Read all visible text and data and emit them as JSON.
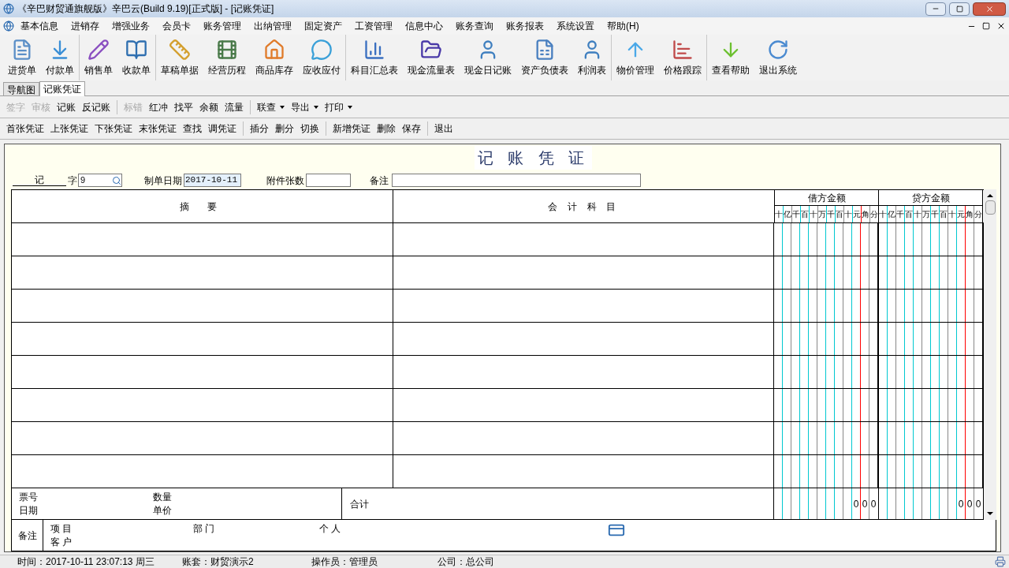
{
  "window": {
    "title": "《辛巴财贸通旗舰版》辛巴云(Build 9.19)[正式版] - [记账凭证]"
  },
  "menu": [
    "基本信息",
    "进销存",
    "增强业务",
    "会员卡",
    "账务管理",
    "出纳管理",
    "固定资产",
    "工资管理",
    "信息中心",
    "账务查询",
    "账务报表",
    "系统设置",
    "帮助(H)"
  ],
  "toolbar": [
    [
      {
        "label": "进货单",
        "kind": "document"
      },
      {
        "label": "付款单",
        "kind": "download"
      }
    ],
    [
      {
        "label": "销售单",
        "kind": "pencil"
      },
      {
        "label": "收款单",
        "kind": "book"
      }
    ],
    [
      {
        "label": "草稿单据",
        "kind": "ruler"
      },
      {
        "label": "经营历程",
        "kind": "film"
      },
      {
        "label": "商品库存",
        "kind": "house"
      },
      {
        "label": "应收应付",
        "kind": "chat"
      }
    ],
    [
      {
        "label": "科目汇总表",
        "kind": "chart"
      },
      {
        "label": "现金流量表",
        "kind": "folder"
      },
      {
        "label": "现金日记账",
        "kind": "person"
      },
      {
        "label": "资产负债表",
        "kind": "report"
      },
      {
        "label": "利润表",
        "kind": "person"
      }
    ],
    [
      {
        "label": "物价管理",
        "kind": "arrow-up"
      },
      {
        "label": "价格跟踪",
        "kind": "bar-chart"
      }
    ],
    [
      {
        "label": "查看帮助",
        "kind": "arrow-down"
      },
      {
        "label": "退出系统",
        "kind": "refresh"
      }
    ]
  ],
  "tabs": [
    {
      "label": "导航图",
      "selected": false
    },
    {
      "label": "记账凭证",
      "selected": true
    }
  ],
  "action_bar": [
    [
      {
        "label": "签字",
        "disabled": true,
        "dropdown": false
      },
      {
        "label": "审核",
        "disabled": true,
        "dropdown": false
      },
      {
        "label": "记账",
        "disabled": false,
        "dropdown": false
      },
      {
        "label": "反记账",
        "disabled": false,
        "dropdown": false
      }
    ],
    [
      {
        "label": "标错",
        "disabled": true,
        "dropdown": false
      },
      {
        "label": "红冲",
        "disabled": false,
        "dropdown": false
      },
      {
        "label": "找平",
        "disabled": false,
        "dropdown": false
      },
      {
        "label": "余额",
        "disabled": false,
        "dropdown": false
      },
      {
        "label": "流量",
        "disabled": false,
        "dropdown": false
      }
    ],
    [
      {
        "label": "联查",
        "disabled": false,
        "dropdown": true
      },
      {
        "label": "导出",
        "disabled": false,
        "dropdown": true
      },
      {
        "label": "打印",
        "disabled": false,
        "dropdown": true
      }
    ]
  ],
  "nav_bar": [
    [
      "首张凭证",
      "上张凭证",
      "下张凭证",
      "末张凭证",
      "查找",
      "调凭证"
    ],
    [
      "插分",
      "删分",
      "切换"
    ],
    [
      "新增凭证",
      "删除",
      "保存"
    ],
    [
      "退出"
    ]
  ],
  "voucher": {
    "title": "记 账 凭 证",
    "type": "记",
    "type_suffix": "字",
    "number": "9",
    "date_label": "制单日期",
    "date": "2017-10-11",
    "attachments_label": "附件张数",
    "note_label": "备注",
    "columns": [
      "摘 要",
      "会 计 科 目"
    ],
    "debit": {
      "label": "借方金额",
      "digits": [
        "十",
        "亿",
        "千",
        "百",
        "十",
        "万",
        "千",
        "百",
        "十",
        "元",
        "角",
        "分"
      ]
    },
    "credit": {
      "label": "贷方金额",
      "digits": [
        "十",
        "亿",
        "千",
        "百",
        "十",
        "万",
        "千",
        "百",
        "十",
        "元",
        "角",
        "分"
      ]
    },
    "footer": {
      "ticket": "票号",
      "date": "日期",
      "quantity": "数量",
      "price": "单价",
      "total_label": "合计",
      "debit_total": [
        "0",
        "0",
        "0"
      ],
      "credit_total": [
        "0",
        "0",
        "0"
      ]
    },
    "memo": {
      "label": "备注",
      "project": "项 目",
      "customer": "客 户",
      "department": "部 门",
      "person": "个 人"
    }
  },
  "status_bar": [
    "时间：2017-10-11 23:07:13 周三",
    "账套：财贸演示2",
    "操作员：管理员",
    "公司：总公司"
  ]
}
